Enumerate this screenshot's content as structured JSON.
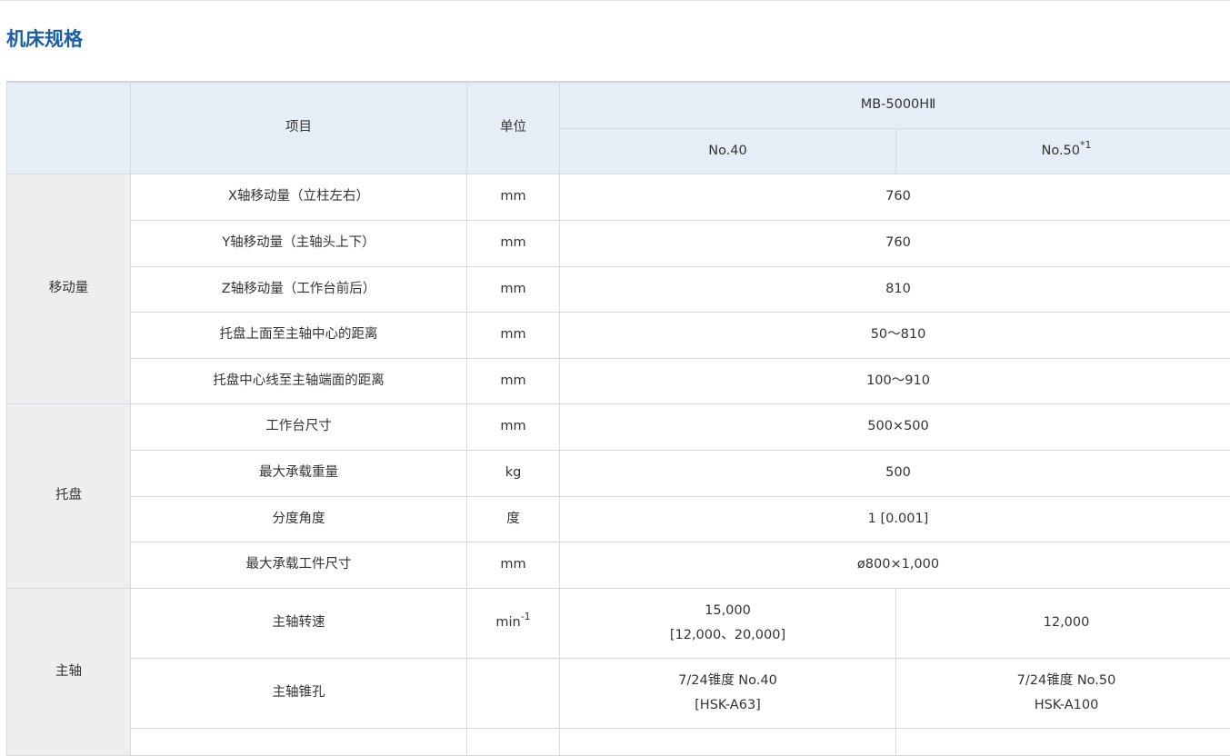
{
  "page": {
    "title": "机床规格"
  },
  "header": {
    "item": "项目",
    "unit": "单位",
    "model": "MB-5000HⅡ",
    "col_a": "No.40",
    "col_b": "No.50",
    "col_b_note": "*1"
  },
  "groups": [
    {
      "category": "移动量",
      "rows": [
        {
          "item": "X轴移动量（立柱左右）",
          "unit": "mm",
          "value": "760"
        },
        {
          "item": "Y轴移动量（主轴头上下）",
          "unit": "mm",
          "value": "760"
        },
        {
          "item": "Z轴移动量（工作台前后）",
          "unit": "mm",
          "value": "810"
        },
        {
          "item": "托盘上面至主轴中心的距离",
          "unit": "mm",
          "value": "50～810"
        },
        {
          "item": "托盘中心线至主轴端面的距离",
          "unit": "mm",
          "value": "100～910"
        }
      ]
    },
    {
      "category": "托盘",
      "rows": [
        {
          "item": "工作台尺寸",
          "unit": "mm",
          "value": "500×500"
        },
        {
          "item": "最大承载重量",
          "unit": "kg",
          "value": "500"
        },
        {
          "item": "分度角度",
          "unit": "度",
          "value": "1 [0.001]"
        },
        {
          "item": "最大承载工件尺寸",
          "unit": "mm",
          "value": "ø800×1,000"
        }
      ]
    },
    {
      "category": "主轴",
      "rows": [
        {
          "item": "主轴转速",
          "unit": "min",
          "unit_sup": "-1",
          "value_a_1": "15,000",
          "value_a_2": "[12,000、20,000]",
          "value_b_1": "12,000"
        },
        {
          "item": "主轴锥孔",
          "unit": "",
          "value_a_1": "7/24锥度 No.40",
          "value_a_2": "[HSK-A63]",
          "value_b_1": "7/24锥度 No.50",
          "value_b_2": "HSK-A100"
        }
      ]
    }
  ]
}
